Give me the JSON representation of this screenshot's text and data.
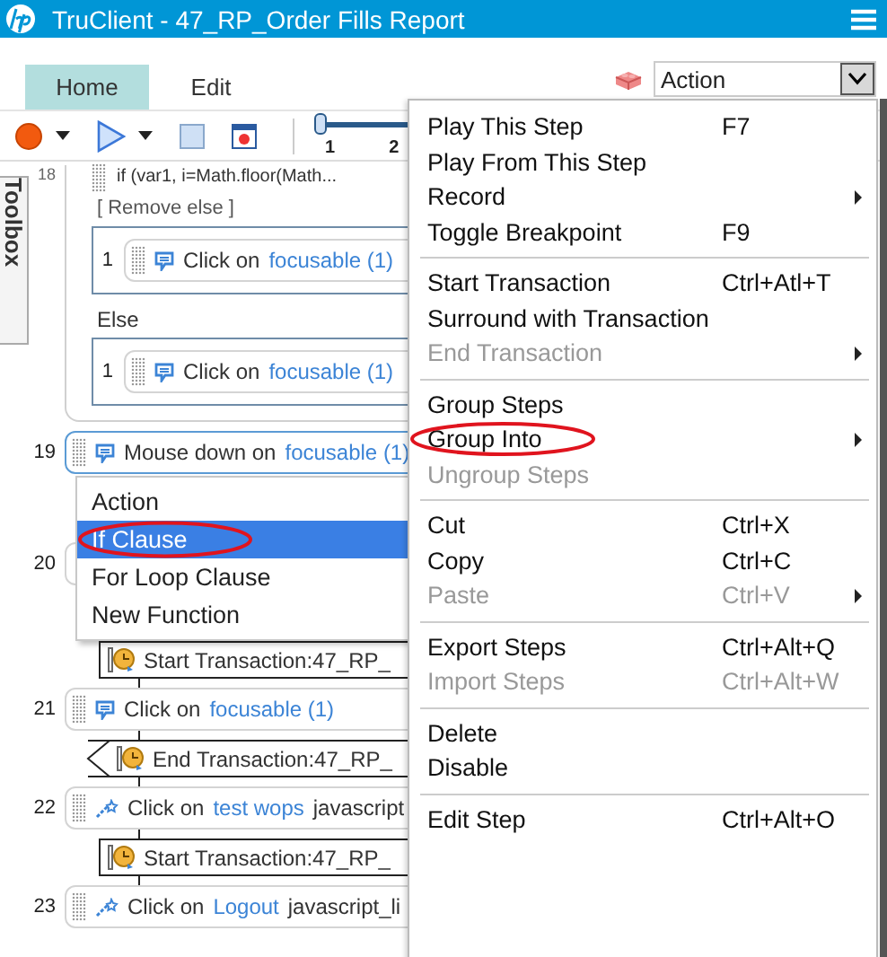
{
  "window": {
    "title": "TruClient - 47_RP_Order Fills Report"
  },
  "tabs": [
    {
      "label": "Home",
      "selected": true
    },
    {
      "label": "Edit",
      "selected": false
    }
  ],
  "action_dropdown": {
    "value": "Action"
  },
  "toolbar": {
    "slider": {
      "level": 0,
      "ticks": [
        "1",
        "2"
      ]
    }
  },
  "toolbox": {
    "label": "Toolbox"
  },
  "steps": [
    {
      "kind": "if_block",
      "number": "18",
      "header": "if (var1, i=Math.floor(Math...",
      "remove_else": "[ Remove else ]",
      "else_label": "Else",
      "then": [
        {
          "number": "1",
          "action": "Click on",
          "target": "focusable (1)"
        }
      ],
      "else": [
        {
          "number": "1",
          "action": "Click on",
          "target": "focusable (1)"
        }
      ]
    },
    {
      "kind": "step",
      "number": "19",
      "action": "Mouse down on",
      "target": "focusable (1)",
      "selected": true
    },
    {
      "kind": "step",
      "number": "20",
      "selected": false
    },
    {
      "kind": "transaction_start",
      "text": "Start Transaction:47_RP_"
    },
    {
      "kind": "step",
      "number": "21",
      "action": "Click on",
      "target": "focusable (1)",
      "selected": false
    },
    {
      "kind": "transaction_end",
      "text": "End Transaction:47_RP_"
    },
    {
      "kind": "js_step",
      "number": "22",
      "action": "Click on",
      "target": "test wops",
      "extra": "javascript",
      "selected": false
    },
    {
      "kind": "transaction_start",
      "text": "Start Transaction:47_RP_"
    },
    {
      "kind": "js_step",
      "number": "23",
      "action": "Click on",
      "target": "Logout",
      "extra": "javascript_li",
      "selected": false
    }
  ],
  "context_menu": {
    "items": [
      {
        "kind": "item",
        "label": "Play This Step",
        "shortcut": "F7",
        "disabled": false
      },
      {
        "kind": "item",
        "label": "Play From This Step",
        "disabled": false
      },
      {
        "kind": "item",
        "label": "Record",
        "disabled": false,
        "submenu": true
      },
      {
        "kind": "item",
        "label": "Toggle Breakpoint",
        "shortcut": "F9",
        "disabled": false
      },
      {
        "kind": "separator"
      },
      {
        "kind": "item",
        "label": "Start Transaction",
        "shortcut": "Ctrl+Atl+T",
        "disabled": false
      },
      {
        "kind": "item",
        "label": "Surround with Transaction",
        "disabled": false
      },
      {
        "kind": "item",
        "label": "End Transaction",
        "disabled": true,
        "submenu": true
      },
      {
        "kind": "separator"
      },
      {
        "kind": "item",
        "label": "Group Steps",
        "disabled": false
      },
      {
        "kind": "item",
        "label": "Group Into",
        "disabled": false,
        "submenu": true,
        "annotated": true
      },
      {
        "kind": "item",
        "label": "Ungroup Steps",
        "disabled": true
      },
      {
        "kind": "separator"
      },
      {
        "kind": "item",
        "label": "Cut",
        "shortcut": "Ctrl+X",
        "disabled": false
      },
      {
        "kind": "item",
        "label": "Copy",
        "shortcut": "Ctrl+C",
        "disabled": false
      },
      {
        "kind": "item",
        "label": "Paste",
        "shortcut": "Ctrl+V",
        "disabled": true,
        "submenu": true
      },
      {
        "kind": "separator"
      },
      {
        "kind": "item",
        "label": "Export Steps",
        "shortcut": "Ctrl+Alt+Q",
        "disabled": false
      },
      {
        "kind": "item",
        "label": "Import Steps",
        "shortcut": "Ctrl+Alt+W",
        "disabled": true
      },
      {
        "kind": "separator"
      },
      {
        "kind": "item",
        "label": "Delete",
        "disabled": false
      },
      {
        "kind": "item",
        "label": "Disable",
        "disabled": false
      },
      {
        "kind": "separator"
      },
      {
        "kind": "item",
        "label": "Edit Step",
        "shortcut": "Ctrl+Alt+O",
        "disabled": false
      }
    ]
  },
  "submenu": {
    "items": [
      {
        "label": "Action",
        "selected": false
      },
      {
        "label": "If Clause",
        "selected": true,
        "annotated": true
      },
      {
        "label": "For Loop Clause",
        "selected": false
      },
      {
        "label": "New Function",
        "selected": false
      }
    ]
  }
}
